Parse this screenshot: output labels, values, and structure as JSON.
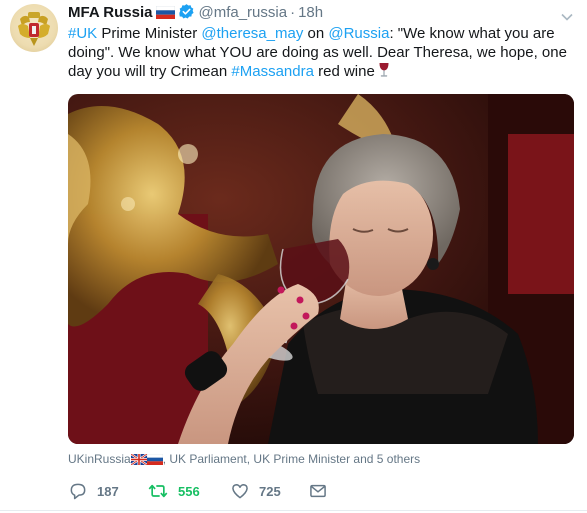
{
  "tweet": {
    "name": "MFA Russia",
    "handle": "@mfa_russia",
    "separator": "·",
    "time": "18h",
    "text": {
      "p1": "#UK",
      "p2": " Prime Minister ",
      "p3": "@theresa_may",
      "p4": " on ",
      "p5": "@Russia",
      "p6": ": \"We know what you are doing\". We know what YOU are doing as well. Dear Theresa, we hope, one day you will try Crimean ",
      "p7": "#Massandra",
      "p8": " red wine"
    },
    "liked_by": {
      "first": "UKinRussia",
      "rest": ", UK Parliament, UK Prime Minister and 5 others"
    },
    "actions": {
      "replies": "187",
      "retweets": "556",
      "likes": "725"
    }
  },
  "colors": {
    "link": "#1da1f2",
    "retweet_active": "#17bf63",
    "secondary_text": "#657786",
    "verified": "#1da1f2"
  },
  "icons": {
    "avatar": "russian-coat-of-arms",
    "verified": "verified-badge-icon",
    "flag": "russia-flag-icon",
    "wine": "wine-glass-emoji",
    "reply": "reply-icon",
    "retweet": "retweet-icon",
    "like": "heart-icon",
    "message": "envelope-icon",
    "caret": "chevron-down-icon"
  }
}
